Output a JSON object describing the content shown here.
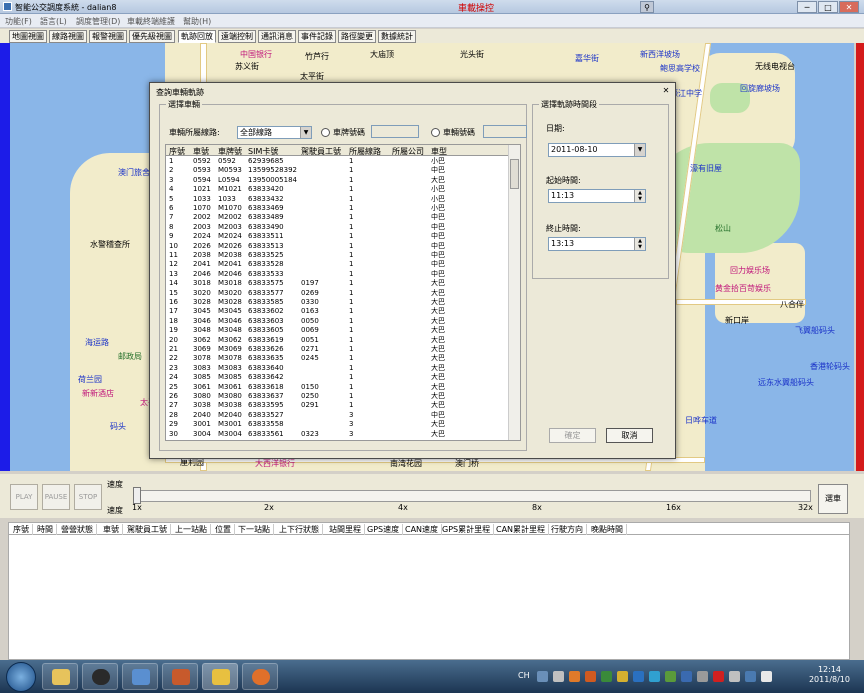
{
  "window": {
    "title": "智能公交調度系統 - dalian8",
    "title_link": "車載操控"
  },
  "menu": [
    "功能(F)",
    "語言(L)",
    "調度管理(D)",
    "車載終端維護",
    "幫助(H)"
  ],
  "tabs": [
    "地圖視圖",
    "線路視圖",
    "報警視圖",
    "優先級視圖",
    "軌跡回放",
    "遠端控制",
    "通訊消息",
    "事件記錄",
    "路徑變更",
    "數據統計"
  ],
  "active_tab": "軌跡回放",
  "map_labels": {
    "blue": [
      "新西洋坡场",
      "鲍思高学校",
      "濠江中学",
      "回旋廊坡场",
      "无线电视台",
      "嘉华街",
      "濠有旧屋",
      "日凭花园",
      "回力娱乐场",
      "黄金拾百苛娱乐",
      "飞翼船码头",
      "新口岸",
      "香港轮码头",
      "远东水翼船码头",
      "日哗车道",
      "澳门旅舍",
      "水警稽查所",
      "海运路",
      "邮政局",
      "荷兰园",
      "新新酒店",
      "码头",
      "厘利园"
    ],
    "pink": [
      "航海码头",
      "太平行银行",
      "大西洋银行",
      "中国银行"
    ],
    "black": [
      "龙花园",
      "苏义街",
      "太平街",
      "大庙顶",
      "八合伴",
      "光头街",
      "竹芦行",
      "大南行",
      "中山",
      "荔枝园",
      "海港花园",
      "南湾花园"
    ],
    "green": [
      "松山",
      "澳门桥"
    ]
  },
  "dialog": {
    "title": "查詢車輛軌跡",
    "vehicle_group": {
      "label": "選擇車輛",
      "route_label": "車輛所屬線路:",
      "route_value": "全部線路",
      "plate_radio": "車牌號碼",
      "vehicle_radio": "車輛號碼",
      "columns": [
        "序號",
        "車號",
        "車牌號",
        "SIM卡號",
        "駕駛員工號",
        "所屬線路",
        "所屬公司",
        "車型"
      ],
      "rows": [
        [
          "1",
          "0592",
          "0592",
          "62939685",
          "",
          "1",
          "",
          "小巴"
        ],
        [
          "2",
          "0593",
          "M0593",
          "13599528392",
          "",
          "1",
          "",
          "中巴"
        ],
        [
          "3",
          "0594",
          "L0594",
          "13950005184",
          "",
          "1",
          "",
          "大巴"
        ],
        [
          "4",
          "1021",
          "M1021",
          "63833420",
          "",
          "1",
          "",
          "小巴"
        ],
        [
          "5",
          "1033",
          "1033",
          "63833432",
          "",
          "1",
          "",
          "小巴"
        ],
        [
          "6",
          "1070",
          "M1070",
          "63833469",
          "",
          "1",
          "",
          "小巴"
        ],
        [
          "7",
          "2002",
          "M2002",
          "63833489",
          "",
          "1",
          "",
          "中巴"
        ],
        [
          "8",
          "2003",
          "M2003",
          "63833490",
          "",
          "1",
          "",
          "中巴"
        ],
        [
          "9",
          "2024",
          "M2024",
          "63833511",
          "",
          "1",
          "",
          "中巴"
        ],
        [
          "10",
          "2026",
          "M2026",
          "63833513",
          "",
          "1",
          "",
          "中巴"
        ],
        [
          "11",
          "2038",
          "M2038",
          "63833525",
          "",
          "1",
          "",
          "中巴"
        ],
        [
          "12",
          "2041",
          "M2041",
          "63833528",
          "",
          "1",
          "",
          "中巴"
        ],
        [
          "13",
          "2046",
          "M2046",
          "63833533",
          "",
          "1",
          "",
          "中巴"
        ],
        [
          "14",
          "3018",
          "M3018",
          "63833575",
          "0197",
          "1",
          "",
          "大巴"
        ],
        [
          "15",
          "3020",
          "M3020",
          "63833577",
          "0269",
          "1",
          "",
          "大巴"
        ],
        [
          "16",
          "3028",
          "M3028",
          "63833585",
          "0330",
          "1",
          "",
          "大巴"
        ],
        [
          "17",
          "3045",
          "M3045",
          "63833602",
          "0163",
          "1",
          "",
          "大巴"
        ],
        [
          "18",
          "3046",
          "M3046",
          "63833603",
          "0050",
          "1",
          "",
          "大巴"
        ],
        [
          "19",
          "3048",
          "M3048",
          "63833605",
          "0069",
          "1",
          "",
          "大巴"
        ],
        [
          "20",
          "3062",
          "M3062",
          "63833619",
          "0051",
          "1",
          "",
          "大巴"
        ],
        [
          "21",
          "3069",
          "M3069",
          "63833626",
          "0271",
          "1",
          "",
          "大巴"
        ],
        [
          "22",
          "3078",
          "M3078",
          "63833635",
          "0245",
          "1",
          "",
          "大巴"
        ],
        [
          "23",
          "3083",
          "M3083",
          "63833640",
          "",
          "1",
          "",
          "大巴"
        ],
        [
          "24",
          "3085",
          "M3085",
          "63833642",
          "",
          "1",
          "",
          "大巴"
        ],
        [
          "25",
          "3061",
          "M3061",
          "63833618",
          "0150",
          "1",
          "",
          "大巴"
        ],
        [
          "26",
          "3080",
          "M3080",
          "63833637",
          "0250",
          "1",
          "",
          "大巴"
        ],
        [
          "27",
          "3038",
          "M3038",
          "63833595",
          "0291",
          "1",
          "",
          "大巴"
        ],
        [
          "28",
          "2040",
          "M2040",
          "63833527",
          "",
          "3",
          "",
          "中巴"
        ],
        [
          "29",
          "3001",
          "M3001",
          "63833558",
          "",
          "3",
          "",
          "大巴"
        ],
        [
          "30",
          "3004",
          "M3004",
          "63833561",
          "0323",
          "3",
          "",
          "大巴"
        ]
      ]
    },
    "time_group": {
      "label": "選擇軌跡時間段",
      "date_label": "日期:",
      "date_value": "2011-08-10",
      "start_label": "起始時間:",
      "start_value": "11:13",
      "end_label": "終止時間:",
      "end_value": "13:13"
    },
    "ok_label": "確定",
    "cancel_label": "取消"
  },
  "playback": {
    "play": "PLAY",
    "pause": "PAUSE",
    "stop": "STOP",
    "speed_label": "速度",
    "ticks": [
      "1x",
      "2x",
      "4x",
      "8x",
      "16x",
      "32x"
    ],
    "select_vehicle": "選車"
  },
  "grid_columns": [
    "序號",
    "時間",
    "營營狀態",
    "車號",
    "駕駛員工號",
    "上一站點",
    "位置",
    "下一站點",
    "上下行狀態",
    "站間里程",
    "GPS速度",
    "CAN速度",
    "GPS累計里程",
    "CAN累計里程",
    "行駛方向",
    "晚點時間"
  ],
  "taskbar": {
    "lang": "CH",
    "time": "12:14",
    "date": "2011/8/10"
  },
  "colors": {
    "map_water": "#8ab6e8",
    "map_land": "#f2eccb",
    "map_park": "#bfe3a8",
    "left_strip": "#1c1ce8",
    "right_strip": "#d41a1a",
    "title_red": "#d00000"
  }
}
